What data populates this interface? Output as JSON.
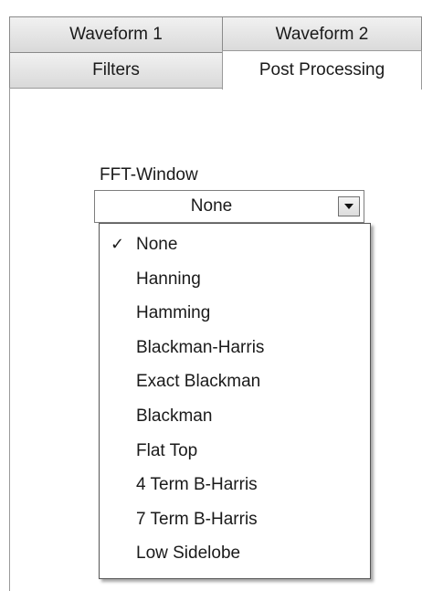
{
  "tabs": {
    "row1": [
      {
        "label": "Waveform 1"
      },
      {
        "label": "Waveform 2"
      }
    ],
    "row2": [
      {
        "label": "Filters"
      },
      {
        "label": "Post Processing",
        "active": true
      }
    ]
  },
  "fft_window": {
    "label": "FFT-Window",
    "selected": "None",
    "check_glyph": "✓",
    "options": [
      "None",
      "Hanning",
      "Hamming",
      "Blackman-Harris",
      "Exact Blackman",
      "Blackman",
      "Flat Top",
      "4 Term B-Harris",
      "7 Term B-Harris",
      "Low Sidelobe"
    ]
  }
}
